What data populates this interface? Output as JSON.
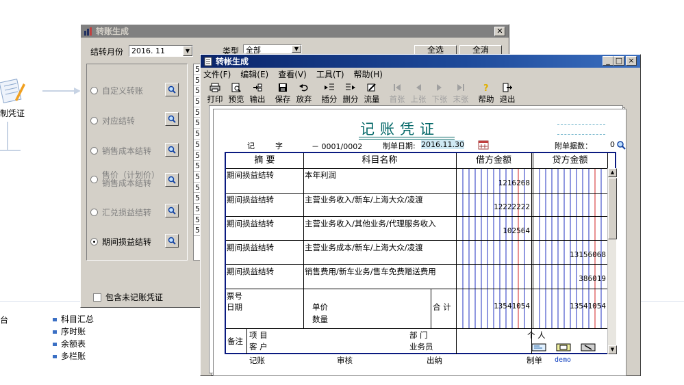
{
  "background": {
    "doc_label": "制凭证",
    "tai_label": "台",
    "list_items": [
      "科目汇总",
      "序时账",
      "余额表",
      "多栏账"
    ]
  },
  "back_dialog": {
    "title": "转账生成",
    "close_glyph": "✕",
    "month_label": "结转月份",
    "month_value": "2016. 11",
    "type_label": "类型",
    "type_value": "全部",
    "btn_select_all": "全选",
    "btn_deselect_all": "全消",
    "options": [
      {
        "label": "自定义转账",
        "checked": false
      },
      {
        "label": "对应结转",
        "checked": false
      },
      {
        "label": "销售成本结转",
        "checked": false
      },
      {
        "label_line1": "售价（计划价）",
        "label_line2": "销售成本结转",
        "checked": false
      },
      {
        "label": "汇兑损益结转",
        "checked": false
      },
      {
        "label": "期间损益结转",
        "checked": true
      }
    ],
    "list_col": [
      "5",
      "5",
      "5",
      "5",
      "5",
      "5",
      "5",
      "5",
      "5",
      "5",
      "5",
      "5",
      "5",
      "5",
      "5",
      "5"
    ],
    "include_unposted": "包含未记账凭证"
  },
  "front_dialog": {
    "title": "转帐生成",
    "win_min": "_",
    "win_max": "□",
    "win_close": "×",
    "menu": [
      "文件(F)",
      "编辑(E)",
      "查看(V)",
      "工具(T)",
      "帮助(H)"
    ],
    "toolbar": [
      {
        "label": "打印",
        "icon": "printer-icon",
        "enabled": true
      },
      {
        "label": "预览",
        "icon": "preview-icon",
        "enabled": true
      },
      {
        "label": "输出",
        "icon": "export-icon",
        "enabled": true
      },
      {
        "label": "保存",
        "icon": "save-icon",
        "enabled": true
      },
      {
        "label": "放弃",
        "icon": "undo-icon",
        "enabled": true
      },
      {
        "label": "插分",
        "icon": "insert-row-icon",
        "enabled": true
      },
      {
        "label": "删分",
        "icon": "delete-row-icon",
        "enabled": true
      },
      {
        "label": "流量",
        "icon": "flow-icon",
        "enabled": true
      },
      {
        "label": "首张",
        "icon": "first-icon",
        "enabled": false
      },
      {
        "label": "上张",
        "icon": "prev-icon",
        "enabled": false
      },
      {
        "label": "下张",
        "icon": "next-icon",
        "enabled": false
      },
      {
        "label": "末张",
        "icon": "last-icon",
        "enabled": false
      },
      {
        "label": "帮助",
        "icon": "help-icon",
        "enabled": true
      },
      {
        "label": "退出",
        "icon": "exit-icon",
        "enabled": true
      }
    ],
    "voucher": {
      "title": "记账凭证",
      "type_char1": "记",
      "type_char2": "字",
      "number": "－ 0001/0002",
      "date_label": "制单日期:",
      "date_value": "2016.11.30",
      "attach_label": "附单据数：",
      "attach_value": "0",
      "headers": {
        "summary": "摘 要",
        "account": "科目名称",
        "debit": "借方金额",
        "credit": "贷方金额"
      },
      "rows": [
        {
          "summary": "期间损益结转",
          "account": "本年利润",
          "debit": "1216268",
          "credit": ""
        },
        {
          "summary": "期间损益结转",
          "account": "主营业务收入/新车/上海大众/凌渡",
          "debit": "12222222",
          "credit": ""
        },
        {
          "summary": "期间损益结转",
          "account": "主营业务收入/其他业务/代理服务收入",
          "debit": "102564",
          "credit": ""
        },
        {
          "summary": "期间损益结转",
          "account": "主营业务成本/新车/上海大众/凌渡",
          "debit": "",
          "credit": "13156068"
        },
        {
          "summary": "期间损益结转",
          "account": "销售费用/新车业务/售车免费赠送费用",
          "debit": "",
          "credit": "386019"
        }
      ],
      "ticket_label": "票号",
      "date_row_label": "日期",
      "unit_price_label": "单价",
      "quantity_label": "数量",
      "total_label": "合 计",
      "total_debit": "13541054",
      "total_credit": "13541054",
      "remark_label": "备注",
      "project_label": "项 目",
      "dept_label": "部 门",
      "person_label": "个 人",
      "customer_label": "客 户",
      "salesman_label": "业务员",
      "footer": {
        "posting": "记账",
        "audit": "审核",
        "cashier": "出纳",
        "maker_label": "制单",
        "maker_value": "demo"
      }
    }
  }
}
